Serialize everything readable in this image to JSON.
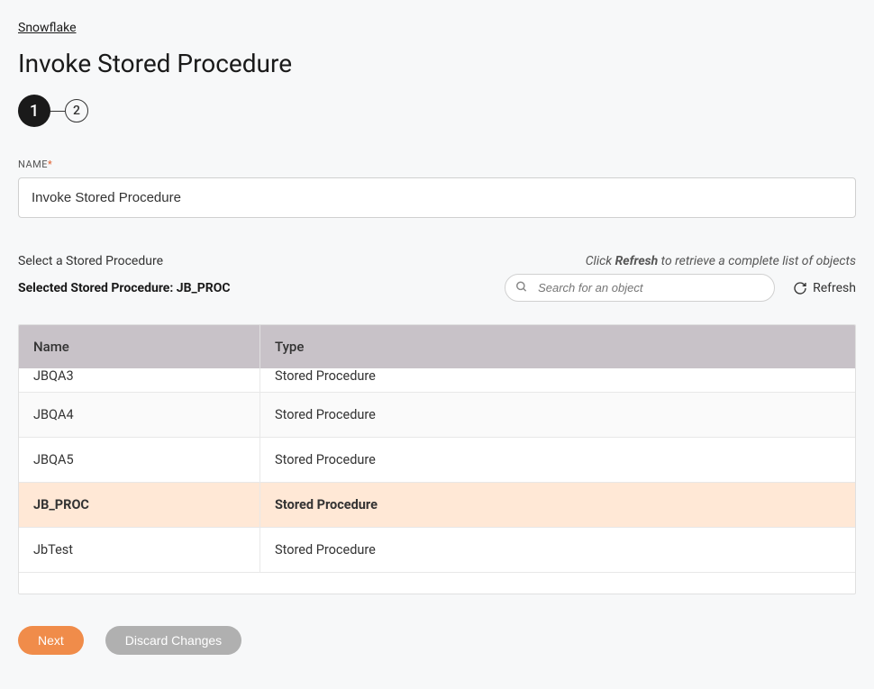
{
  "breadcrumb": "Snowflake",
  "page_title": "Invoke Stored Procedure",
  "stepper": {
    "step1": "1",
    "step2": "2"
  },
  "name_field": {
    "label": "NAME",
    "value": "Invoke Stored Procedure"
  },
  "section": {
    "select_label": "Select a Stored Procedure",
    "hint_prefix": "Click ",
    "hint_bold": "Refresh",
    "hint_suffix": " to retrieve a complete list of objects",
    "selected_label_prefix": "Selected Stored Procedure: ",
    "selected_value": "JB_PROC"
  },
  "search": {
    "placeholder": "Search for an object"
  },
  "refresh_label": "Refresh",
  "table": {
    "headers": {
      "name": "Name",
      "type": "Type"
    },
    "rows": [
      {
        "name": "JBQA3",
        "type": "Stored Procedure",
        "partial": true
      },
      {
        "name": "JBQA4",
        "type": "Stored Procedure"
      },
      {
        "name": "JBQA5",
        "type": "Stored Procedure"
      },
      {
        "name": "JB_PROC",
        "type": "Stored Procedure",
        "selected": true
      },
      {
        "name": "JbTest",
        "type": "Stored Procedure"
      }
    ]
  },
  "buttons": {
    "next": "Next",
    "discard": "Discard Changes"
  }
}
